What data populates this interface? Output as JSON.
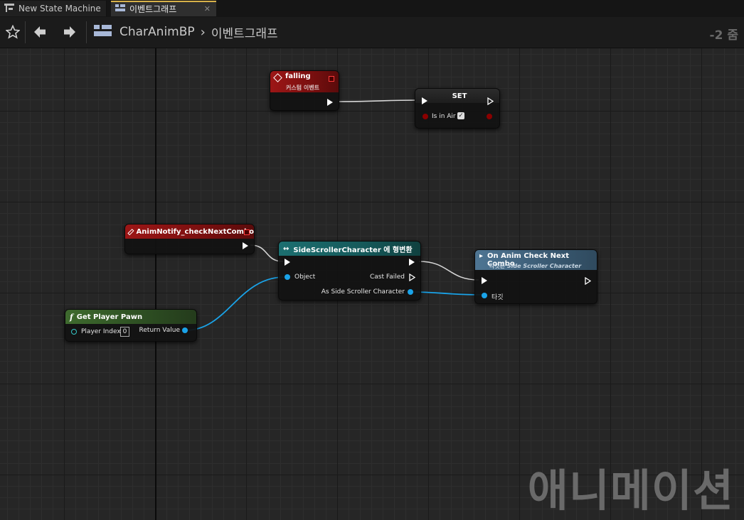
{
  "tabs": [
    {
      "label": "New State Machine",
      "icon": "state-machine-icon"
    },
    {
      "label": "이벤트그래프",
      "icon": "graph-icon",
      "active": true
    }
  ],
  "toolbar": {
    "breadcrumb": [
      "CharAnimBP",
      "이벤트그래프"
    ],
    "zoom": "-2 줌"
  },
  "nodes": {
    "falling": {
      "title": "falling",
      "subtitle": "커스텀 이벤트"
    },
    "set": {
      "title": "SET",
      "var_label": "Is in Air",
      "checked": true
    },
    "anim_notify": {
      "title": "AnimNotify_checkNextCombo"
    },
    "cast": {
      "title": "SideScrollerCharacter 에 형변환",
      "object_label": "Object",
      "cast_failed": "Cast Failed",
      "as_label": "As Side Scroller Character"
    },
    "call": {
      "title": "On Anim Check Next Combo",
      "subtitle_prefix": "타깃은 ",
      "subtitle_target": "Side Scroller Character",
      "target_label": "타깃"
    },
    "get_pawn": {
      "title": "Get Player Pawn",
      "param_label": "Player Index",
      "param_value": "0",
      "return_label": "Return Value"
    }
  },
  "watermark": "애니메이션",
  "colors": {
    "event_red": "#9c1616",
    "cast_teal": "#1c6f70",
    "func_green": "#3e6a2e",
    "call_blue": "#4e7593",
    "object_pin": "#1aa3e8",
    "bool_pin": "#8a0000"
  }
}
